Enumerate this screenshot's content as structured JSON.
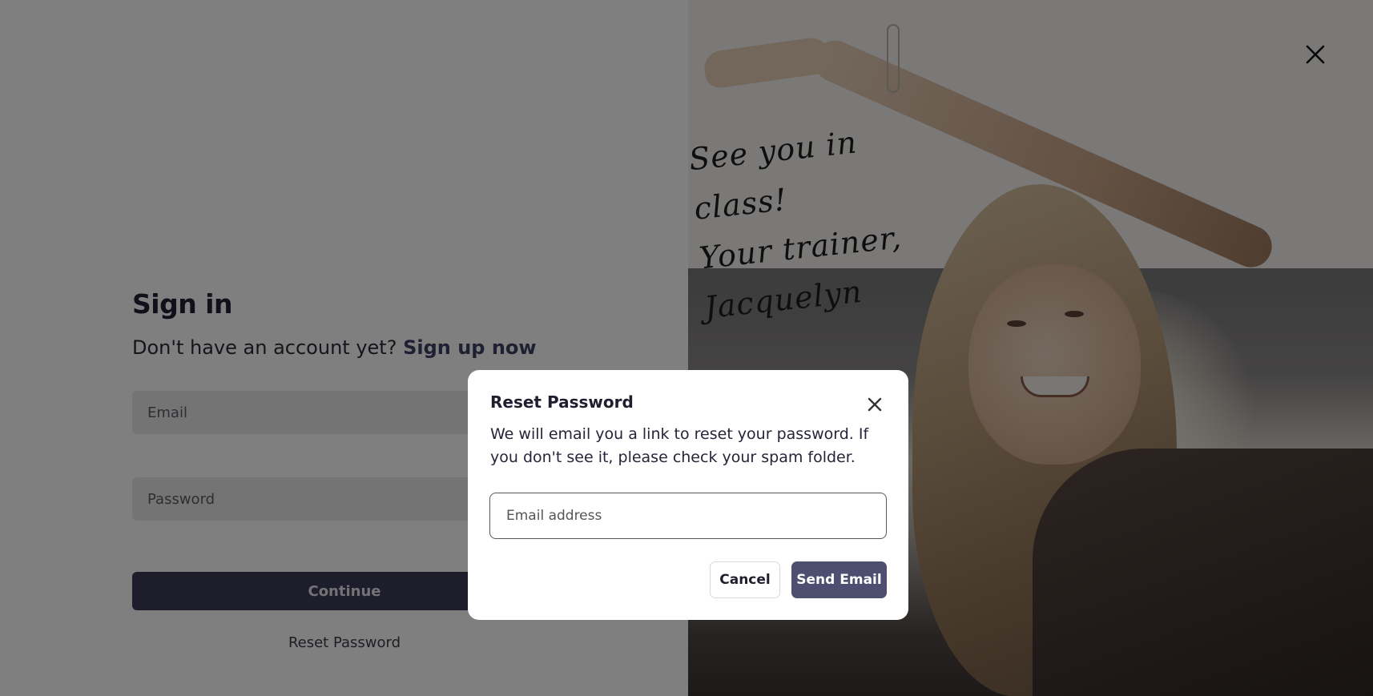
{
  "signin": {
    "title": "Sign in",
    "prompt": "Don't have an account yet?",
    "signup_link": "Sign up now",
    "email_placeholder": "Email",
    "password_placeholder": "Password",
    "continue_label": "Continue",
    "reset_link": "Reset Password"
  },
  "photo": {
    "signature_line1": "See you in class!",
    "signature_line2": "Your trainer, Jacquelyn"
  },
  "icons": {
    "page_close": "close-icon",
    "modal_close": "close-icon"
  },
  "modal": {
    "title": "Reset Password",
    "description": "We will email you a link to reset your password. If you don't see it, please check your spam folder.",
    "email_placeholder": "Email address",
    "cancel_label": "Cancel",
    "send_label": "Send Email"
  },
  "colors": {
    "primary": "#3a3b57",
    "send_button": "#4e4f70",
    "link": "#3f4063"
  }
}
